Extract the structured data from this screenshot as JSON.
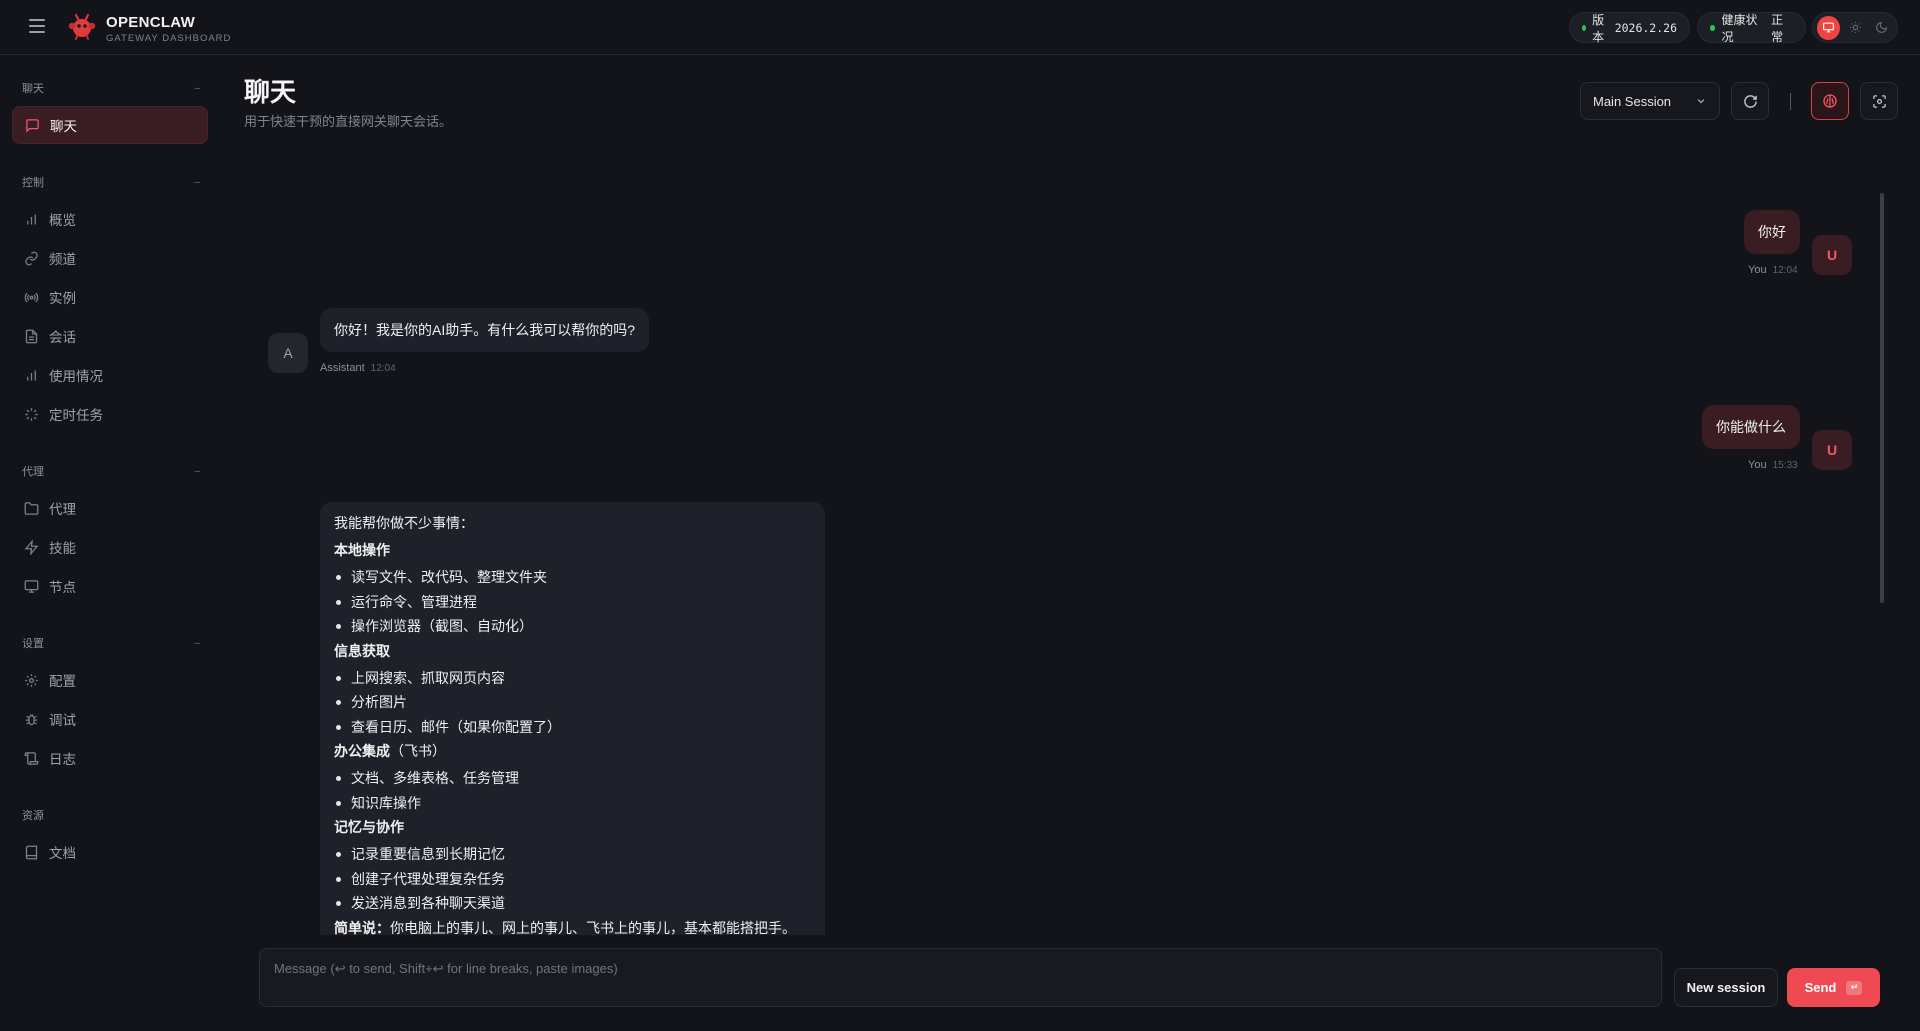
{
  "app": {
    "brand_title": "OPENCLAW",
    "brand_subtitle": "GATEWAY DASHBOARD",
    "version_label": "版本",
    "version_value": "2026.2.26",
    "health_label": "健康状况",
    "health_value": "正常"
  },
  "sidebar": {
    "sections": [
      {
        "title": "聊天",
        "items": [
          {
            "label": "聊天",
            "icon": "chat-icon",
            "active": true
          }
        ]
      },
      {
        "title": "控制",
        "items": [
          {
            "label": "概览",
            "icon": "bar-chart-icon"
          },
          {
            "label": "频道",
            "icon": "link-icon"
          },
          {
            "label": "实例",
            "icon": "radio-icon"
          },
          {
            "label": "会话",
            "icon": "file-icon"
          },
          {
            "label": "使用情况",
            "icon": "bar-chart-icon"
          },
          {
            "label": "定时任务",
            "icon": "loader-icon"
          }
        ]
      },
      {
        "title": "代理",
        "items": [
          {
            "label": "代理",
            "icon": "folder-icon"
          },
          {
            "label": "技能",
            "icon": "zap-icon"
          },
          {
            "label": "节点",
            "icon": "monitor-icon"
          }
        ]
      },
      {
        "title": "设置",
        "items": [
          {
            "label": "配置",
            "icon": "gear-icon"
          },
          {
            "label": "调试",
            "icon": "bug-icon"
          },
          {
            "label": "日志",
            "icon": "scroll-icon"
          }
        ]
      },
      {
        "title": "资源",
        "items": [
          {
            "label": "文档",
            "icon": "book-icon"
          }
        ]
      }
    ]
  },
  "header": {
    "title": "聊天",
    "subtitle": "用于快速干预的直接网关聊天会话。",
    "session_value": "Main Session"
  },
  "messages": [
    {
      "role": "user",
      "avatar": "U",
      "text": "你好",
      "sender": "You",
      "time": "12:04"
    },
    {
      "role": "assistant",
      "avatar": "A",
      "text": "你好！我是你的AI助手。有什么我可以帮你的吗?",
      "sender": "Assistant",
      "time": "12:04"
    },
    {
      "role": "user",
      "avatar": "U",
      "text": "你能做什么",
      "sender": "You",
      "time": "15:33"
    }
  ],
  "long_reply": {
    "intro": "我能帮你做不少事情：",
    "groups": [
      {
        "heading": "本地操作",
        "suffix": "",
        "items": [
          "读写文件、改代码、整理文件夹",
          "运行命令、管理进程",
          "操作浏览器（截图、自动化）"
        ]
      },
      {
        "heading": "信息获取",
        "suffix": "",
        "items": [
          "上网搜索、抓取网页内容",
          "分析图片",
          "查看日历、邮件（如果你配置了）"
        ]
      },
      {
        "heading": "办公集成",
        "suffix": "（飞书）",
        "items": [
          "文档、多维表格、任务管理",
          "知识库操作"
        ]
      },
      {
        "heading": "记忆与协作",
        "suffix": "",
        "items": [
          "记录重要信息到长期记忆",
          "创建子代理处理复杂任务",
          "发送消息到各种聊天渠道"
        ]
      }
    ],
    "summary_bold": "简单说：",
    "summary_text": "你电脑上的事儿、网上的事儿、飞书上的事儿，基本都能搭把手。"
  },
  "composer": {
    "placeholder": "Message (↩ to send, Shift+↩ for line breaks, paste images)",
    "new_session_label": "New session",
    "send_label": "Send",
    "send_key": "↵"
  },
  "colors": {
    "accent": "#ef4a54",
    "status_ok": "#22c55e",
    "background": "#12141a"
  }
}
